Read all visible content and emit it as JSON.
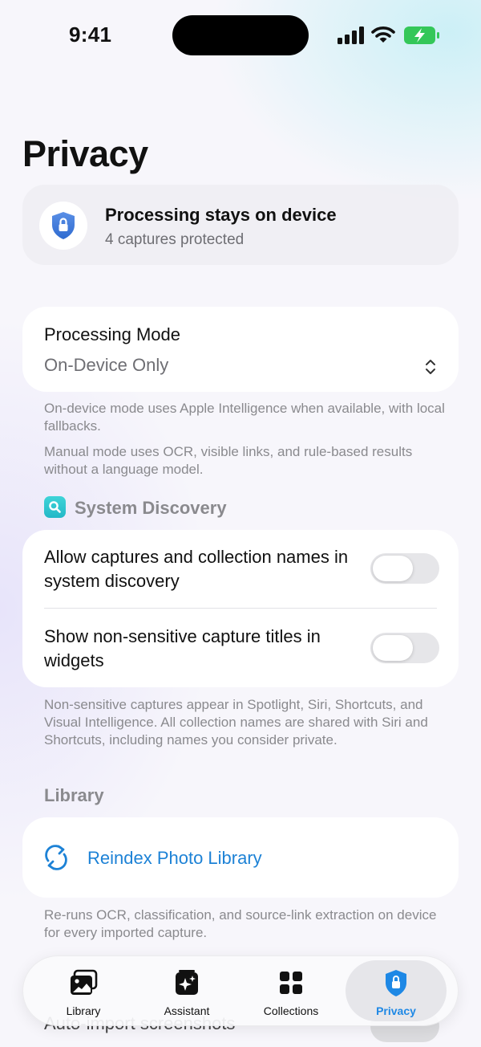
{
  "status_bar": {
    "time": "9:41"
  },
  "page": {
    "title": "Privacy"
  },
  "summary": {
    "title": "Processing stays on device",
    "subtitle": "4 captures protected",
    "icon": "lock-shield-icon"
  },
  "processing": {
    "label": "Processing Mode",
    "value": "On-Device Only",
    "note1": "On-device mode uses Apple Intelligence when available, with local fallbacks.",
    "note2": "Manual mode uses OCR, visible links, and rule-based results without a language model."
  },
  "system_discovery": {
    "header": "System Discovery",
    "rows": [
      {
        "label": "Allow captures and collection names in system discovery",
        "on": false
      },
      {
        "label": "Show non-sensitive capture titles in widgets",
        "on": false
      }
    ],
    "note": "Non-sensitive captures appear in Spotlight, Siri, Shortcuts, and Visual Intelligence. All collection names are shared with Siri and Shortcuts, including names you consider private."
  },
  "library": {
    "header": "Library",
    "reindex_label": "Reindex Photo Library",
    "note": "Re-runs OCR, classification, and source-link extraction on device for every imported capture.",
    "partial_row": "Auto-import screenshots"
  },
  "tab_bar": {
    "tabs": [
      {
        "label": "Library",
        "icon": "photo-library-icon",
        "active": false
      },
      {
        "label": "Assistant",
        "icon": "sparkles-icon",
        "active": false
      },
      {
        "label": "Collections",
        "icon": "grid-icon",
        "active": false
      },
      {
        "label": "Privacy",
        "icon": "shield-lock-icon",
        "active": true
      }
    ]
  },
  "colors": {
    "accent": "#1e88e5",
    "link": "#1d82d6",
    "shield": "#3b7ddd",
    "secondary_text": "#8a8a8e",
    "battery_green": "#34c759"
  }
}
